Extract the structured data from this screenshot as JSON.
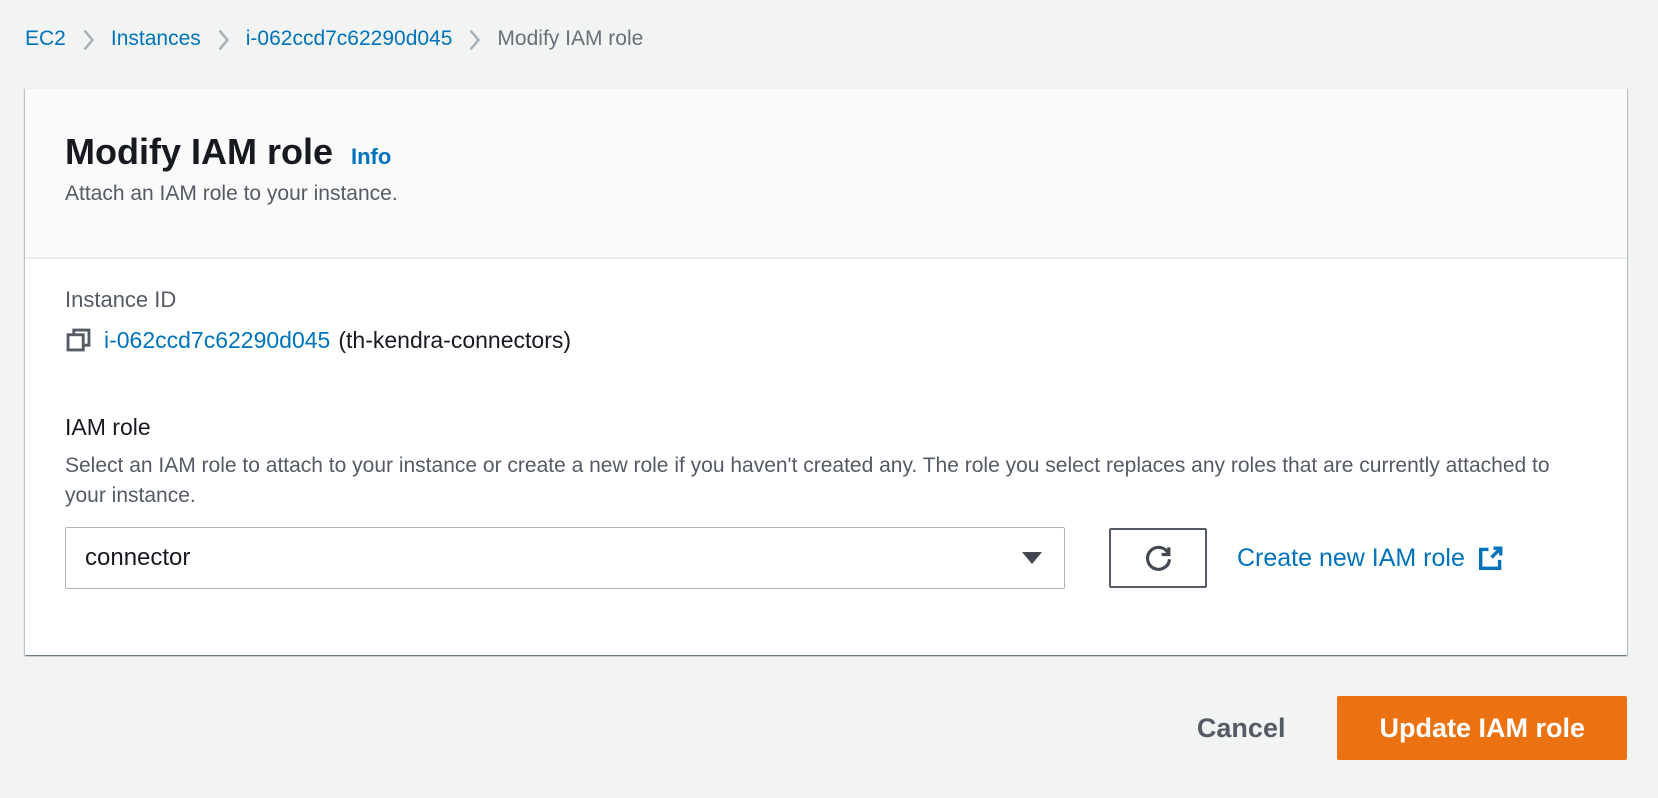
{
  "breadcrumb": {
    "items": [
      {
        "label": "EC2"
      },
      {
        "label": "Instances"
      },
      {
        "label": "i-062ccd7c62290d045"
      },
      {
        "label": "Modify IAM role"
      }
    ]
  },
  "panel": {
    "title": "Modify IAM role",
    "info_label": "Info",
    "subtitle": "Attach an IAM role to your instance.",
    "instance": {
      "label": "Instance ID",
      "id_link": "i-062ccd7c62290d045",
      "name_suffix": "(th-kendra-connectors)"
    },
    "iam_role": {
      "label": "IAM role",
      "description": "Select an IAM role to attach to your instance or create a new role if you haven't created any. The role you select replaces any roles that are currently attached to your instance.",
      "selected_value": "connector",
      "create_link_label": "Create new IAM role"
    }
  },
  "footer": {
    "cancel_label": "Cancel",
    "submit_label": "Update IAM role"
  },
  "icons": {
    "copy": "copy-icon",
    "refresh": "refresh-icon",
    "caret": "chevron-down-caret-icon",
    "external": "external-link-icon",
    "separator": "breadcrumb-chevron-icon"
  },
  "colors": {
    "background": "#f2f3f3",
    "link_blue": "#0073bb",
    "primary_orange": "#ec7211",
    "text_dark": "#16191f",
    "text_secondary": "#545b64",
    "divider": "#eaeded",
    "select_border": "#aab7b8"
  }
}
